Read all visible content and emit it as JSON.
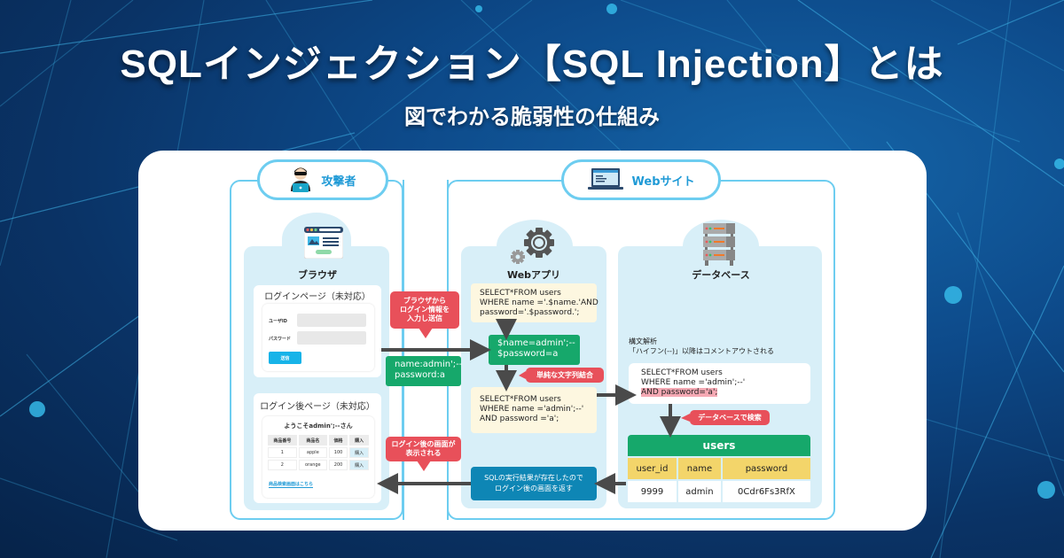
{
  "header": {
    "title": "SQLインジェクション【SQL Injection】とは",
    "subtitle": "図でわかる脆弱性の仕組み"
  },
  "attacker": {
    "label": "攻撃者",
    "icon": "hacker-icon",
    "browser": {
      "label": "ブラウザ",
      "icon": "browser-window-icon",
      "login_page": {
        "heading": "ログインページ（未対応）",
        "user_id_label": "ユーザID",
        "password_label": "パスワード",
        "submit_label": "送信"
      },
      "after_login_page": {
        "heading": "ログイン後ページ（未対応）",
        "welcome": "ようこそadmin';--さん",
        "columns": [
          "商品番号",
          "商品名",
          "価格",
          "購入"
        ],
        "rows": [
          [
            "1",
            "apple",
            "100",
            "購入"
          ],
          [
            "2",
            "orange",
            "200",
            "購入"
          ]
        ],
        "search_link": "商品検索画面はこちら"
      }
    }
  },
  "website": {
    "label": "Webサイト",
    "icon": "laptop-icon",
    "webapp": {
      "label": "Webアプリ",
      "icon": "gears-icon",
      "query_template": [
        "SELECT*FROM users",
        "WHERE name ='.$name.'AND",
        "password='.$password.';"
      ],
      "variables": [
        "$name=admin';--",
        "$password=a"
      ],
      "concat_note": "単純な文字列結合",
      "built_query": [
        "SELECT*FROM users",
        "WHERE name ='admin';--'",
        "AND password ='a';"
      ],
      "result_note": [
        "SQLの実行結果が存在したので",
        "ログイン後の画面を返す"
      ]
    },
    "database": {
      "label": "データベース",
      "icon": "server-rack-icon",
      "parse_note": [
        "構文解析",
        "「ハイフン(--)」以降はコメントアウトされる"
      ],
      "parsed_query": [
        "SELECT*FROM users",
        "WHERE name ='admin';--'",
        "AND password='a';"
      ],
      "search_note": "データベースで検索",
      "table": {
        "name": "users",
        "columns": [
          "user_id",
          "name",
          "password"
        ],
        "rows": [
          [
            "9999",
            "admin",
            "0Cdr6Fs3RfX"
          ]
        ]
      }
    }
  },
  "flow": {
    "send_note": [
      "ブラウザから",
      "ログイン情報を",
      "入力し送信"
    ],
    "input_values": [
      "name:admin';--",
      "password:a"
    ],
    "display_note": [
      "ログイン後の画面が",
      "表示される"
    ]
  },
  "colors": {
    "accent_blue": "#1f9ad6",
    "frame_blue": "#6dcdf0",
    "green": "#16a86b",
    "red": "#e8505a",
    "code_bg": "#fdf7e0",
    "header_yellow": "#f3d56a"
  }
}
